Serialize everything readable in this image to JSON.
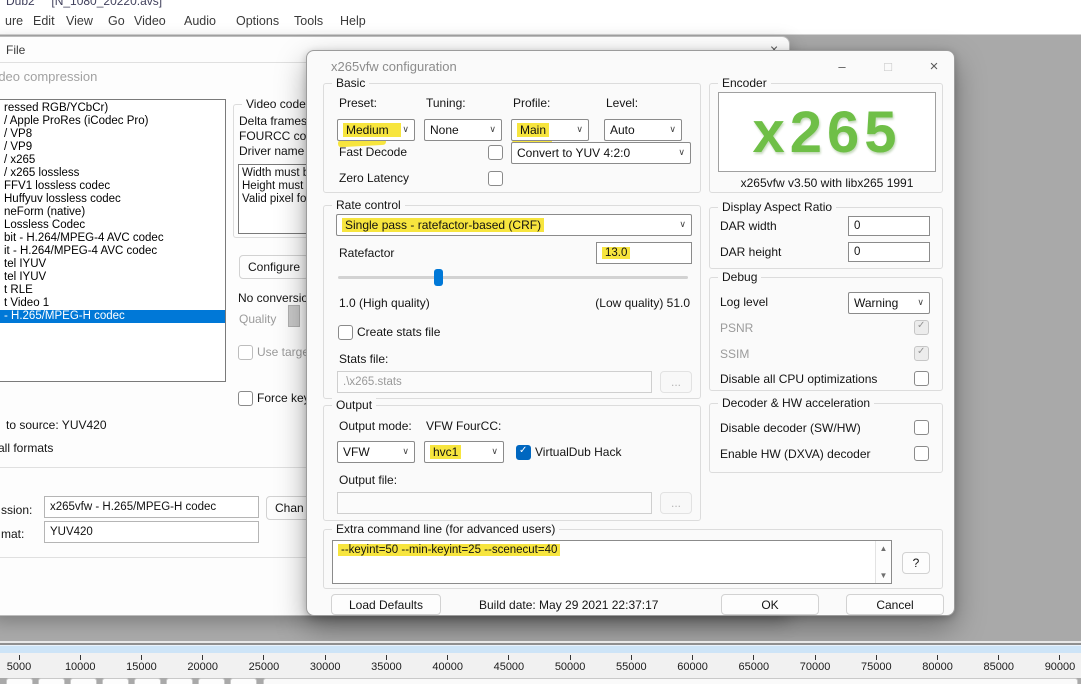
{
  "titlebar": {
    "fragment": "Dub2     [N_1080_20220.avs]"
  },
  "menubar": {
    "items": [
      "ure",
      "Edit",
      "View",
      "Go",
      "Video",
      "Audio",
      "Options",
      "Tools",
      "Help"
    ]
  },
  "file_window": {
    "file_menu": "File",
    "close_icon": "×"
  },
  "compression_dialog": {
    "title": "Video compression",
    "codecs": [
      "ressed RGB/YCbCr)",
      "/ Apple ProRes (iCodec Pro)",
      "/ VP8",
      "/ VP9",
      "/ x265",
      "/ x265 lossless",
      "FFV1 lossless codec",
      "Huffyuv lossless codec",
      "neForm (native)",
      "Lossless Codec",
      "bit - H.264/MPEG-4 AVC codec",
      "it - H.264/MPEG-4 AVC codec",
      "tel IYUV",
      "tel IYUV",
      "t RLE",
      "t Video 1",
      "- H.265/MPEG-H codec"
    ],
    "selected_codec_index": 16,
    "info": {
      "group_label": "Video codec in",
      "delta_frames": "Delta frames",
      "fourcc_code": "FOURCC code",
      "driver_name": "Driver name",
      "box_line1": "Width must b",
      "box_line2": "Height must l",
      "box_line3": "Valid pixel for",
      "configure": "Configure",
      "no_conversion": "No conversion",
      "quality": "Quality",
      "use_target": "Use target",
      "force_key": "Force keyfr"
    },
    "footer": {
      "to_source": "to source: YUV420",
      "all_formats": "all formats",
      "compression_label": "ssion:",
      "compression_value": "x265vfw - H.265/MPEG-H codec",
      "format_label": "mat:",
      "format_value": "YUV420",
      "change_button": "Chan"
    }
  },
  "dialog": {
    "title": "x265vfw configuration",
    "window_controls": {
      "minimize": "–",
      "maximize": "□",
      "close": "×"
    },
    "basic": {
      "label": "Basic",
      "preset_label": "Preset:",
      "preset_value": "Medium",
      "tuning_label": "Tuning:",
      "tuning_value": "None",
      "profile_label": "Profile:",
      "profile_value": "Main",
      "level_label": "Level:",
      "level_value": "Auto",
      "fast_decode": "Fast Decode",
      "convert_value": "Convert to YUV 4:2:0",
      "zero_latency": "Zero Latency"
    },
    "encoder": {
      "label": "Encoder",
      "logo": "x265",
      "version": "x265vfw v3.50 with libx265 1991"
    },
    "rate_control": {
      "label": "Rate control",
      "mode": "Single pass - ratefactor-based (CRF)",
      "ratefactor_label": "Ratefactor",
      "ratefactor_value": "13.0",
      "high": "1.0 (High quality)",
      "low": "(Low quality) 51.0",
      "create_stats": "Create stats file",
      "stats_file_label": "Stats file:",
      "stats_file_value": ".\\x265.stats",
      "browse": "..."
    },
    "output": {
      "label": "Output",
      "mode_label": "Output mode:",
      "mode_value": "VFW",
      "fourcc_label": "VFW FourCC:",
      "fourcc_value": "hvc1",
      "vdub_hack": "VirtualDub Hack",
      "file_label": "Output file:",
      "browse": "..."
    },
    "dar": {
      "label": "Display Aspect Ratio",
      "width_label": "DAR width",
      "width_value": "0",
      "height_label": "DAR height",
      "height_value": "0"
    },
    "debug": {
      "label": "Debug",
      "log_label": "Log level",
      "log_value": "Warning",
      "psnr": "PSNR",
      "ssim": "SSIM",
      "cpu": "Disable all CPU optimizations"
    },
    "decoder": {
      "label": "Decoder & HW acceleration",
      "disable": "Disable decoder (SW/HW)",
      "enable": "Enable HW (DXVA) decoder"
    },
    "extra": {
      "label": "Extra command line (for advanced users)",
      "value": "--keyint=50 --min-keyint=25 --scenecut=40",
      "help": "?"
    },
    "footer": {
      "load_defaults": "Load Defaults",
      "build": "Build date: May 29 2021 22:37:17",
      "ok": "OK",
      "cancel": "Cancel"
    }
  },
  "timeline": {
    "ticks": [
      5000,
      10000,
      15000,
      20000,
      25000,
      30000,
      35000,
      40000,
      45000,
      50000,
      55000,
      60000,
      65000,
      70000,
      75000,
      80000,
      85000,
      90000
    ]
  },
  "colors": {
    "highlight": "#f7e53e",
    "selection": "#0078d7",
    "accent_checkbox": "#0067c0",
    "desktop": "#a9a9a9",
    "timeline_strip": "#cde4f7",
    "logo_green": "#6fbf47"
  }
}
